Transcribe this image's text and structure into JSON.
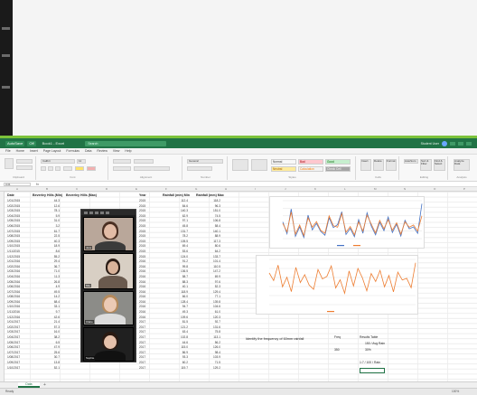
{
  "window": {
    "title_buttons": [
      "AutoSave",
      "Off"
    ],
    "doc_name": "Book1 - Excel",
    "search_placeholder": "Search",
    "user": "Student User",
    "controls": [
      "minimize",
      "maximize",
      "close"
    ]
  },
  "menu": [
    "File",
    "Home",
    "Insert",
    "Page Layout",
    "Formulas",
    "Data",
    "Review",
    "View",
    "Help"
  ],
  "ribbon": {
    "groups": [
      "Clipboard",
      "Font",
      "Alignment",
      "Number",
      "Styles",
      "Cells",
      "Editing",
      "Analysis"
    ],
    "font_name": "Calibri",
    "font_size": "11",
    "number_format": "General",
    "styles": [
      {
        "label": "Normal",
        "color": "#ffffff"
      },
      {
        "label": "Bad",
        "color": "#ffc7ce"
      },
      {
        "label": "Good",
        "color": "#c6efce"
      },
      {
        "label": "Neutral",
        "color": "#ffeb9c"
      },
      {
        "label": "Calculation",
        "color": "#f2f2f2"
      },
      {
        "label": "Check Cell",
        "color": "#a5a5a5"
      }
    ],
    "cells_buttons": [
      "Insert",
      "Delete",
      "Format"
    ],
    "editing_buttons": [
      "AutoSum",
      "Sort & Filter",
      "Find & Select"
    ],
    "analysis_button": "Analyze Data"
  },
  "formula_bar": {
    "name_box": "C41",
    "fx": "fx"
  },
  "columns": [
    "A",
    "B",
    "C",
    "D",
    "E",
    "F",
    "G",
    "H",
    "I",
    "J",
    "K",
    "L",
    "M",
    "N",
    "O",
    "P"
  ],
  "table": {
    "headers": [
      "Date",
      "Beverley Hills (Min)",
      "Beverley Hills (Max)",
      "Year",
      "Rainfall (mm) Min",
      "Rainfall (mm) Max"
    ],
    "dates": [
      "1/01/2015",
      "1/02/2015",
      "1/03/2015",
      "1/04/2015",
      "1/05/2015",
      "1/06/2015",
      "1/07/2015",
      "1/08/2015",
      "1/09/2015",
      "1/10/2015",
      "1/11/2015",
      "1/12/2015",
      "1/01/2016",
      "1/02/2016",
      "1/03/2016",
      "1/04/2016",
      "1/05/2016",
      "1/06/2016",
      "1/07/2016",
      "1/08/2016",
      "1/09/2016",
      "1/10/2016",
      "1/11/2016",
      "1/12/2016",
      "1/01/2017",
      "1/02/2017",
      "1/03/2017",
      "1/04/2017",
      "1/05/2017",
      "1/06/2017",
      "1/07/2017",
      "1/08/2017",
      "1/09/2017",
      "1/10/2017"
    ],
    "min": [
      "44.3",
      "12.6",
      "78.1",
      "5.9",
      "31.0",
      "3.2",
      "61.7",
      "22.5",
      "40.3",
      "18.9",
      "8.6",
      "55.2",
      "29.4",
      "36.7",
      "71.0",
      "11.3",
      "26.8",
      "4.9",
      "49.5",
      "14.2",
      "68.4",
      "33.1",
      "9.7",
      "42.6",
      "21.4",
      "57.3",
      "16.0",
      "38.2",
      "6.5",
      "47.9",
      "25.6",
      "30.7",
      "13.8",
      "52.1"
    ],
    "year": [
      "2015",
      "2015",
      "2015",
      "2015",
      "2015",
      "2015",
      "2015",
      "2015",
      "2015",
      "2015",
      "2015",
      "2015",
      "2016",
      "2016",
      "2016",
      "2016",
      "2016",
      "2016",
      "2016",
      "2016",
      "2016",
      "2016",
      "2016",
      "2016",
      "2017",
      "2017",
      "2017",
      "2017",
      "2017",
      "2017",
      "2017",
      "2017",
      "2017",
      "2017"
    ],
    "rain_min": [
      "112.4",
      "84.6",
      "140.3",
      "62.9",
      "97.1",
      "45.8",
      "131.7",
      "78.2",
      "105.5",
      "69.4",
      "53.6",
      "124.0",
      "91.2",
      "99.8",
      "136.5",
      "58.7",
      "88.3",
      "40.1",
      "118.9",
      "66.0",
      "128.4",
      "94.7",
      "49.3",
      "109.6",
      "81.5",
      "121.2",
      "63.4",
      "102.8",
      "44.6",
      "115.0",
      "86.9",
      "93.3",
      "60.2",
      "119.7"
    ],
    "rain_max": [
      "118.2",
      "96.3",
      "151.0",
      "74.5",
      "106.8",
      "58.4",
      "140.1",
      "88.9",
      "117.3",
      "80.6",
      "64.2",
      "133.7",
      "101.4",
      "110.5",
      "147.2",
      "69.9",
      "97.6",
      "52.3",
      "129.4",
      "77.1",
      "139.8",
      "104.6",
      "61.0",
      "120.3",
      "92.7",
      "131.6",
      "75.8",
      "113.1",
      "56.2",
      "126.0",
      "98.4",
      "103.9",
      "71.5",
      "129.2"
    ]
  },
  "video_call": {
    "participants": [
      "Jess",
      "Mia",
      "Claire",
      "Sophie"
    ]
  },
  "chart_data": [
    {
      "type": "line",
      "x": [
        "1",
        "2",
        "3",
        "4",
        "5",
        "6",
        "7",
        "8",
        "9",
        "10",
        "11",
        "12",
        "13",
        "14",
        "15",
        "16",
        "17",
        "18",
        "19",
        "20",
        "21",
        "22",
        "23",
        "24",
        "25",
        "26",
        "27",
        "28",
        "29",
        "30",
        "31",
        "32",
        "33",
        "34"
      ],
      "series": [
        {
          "name": "",
          "color": "#4472c4",
          "values": [
            44,
            13,
            78,
            6,
            31,
            3,
            62,
            23,
            40,
            19,
            9,
            55,
            29,
            37,
            71,
            11,
            27,
            5,
            50,
            14,
            68,
            33,
            10,
            43,
            21,
            57,
            16,
            38,
            7,
            48,
            26,
            31,
            14,
            92
          ]
        },
        {
          "name": "",
          "color": "#ed7d31",
          "values": [
            40,
            18,
            70,
            12,
            36,
            8,
            55,
            30,
            45,
            22,
            14,
            60,
            34,
            30,
            66,
            17,
            32,
            10,
            44,
            20,
            62,
            38,
            15,
            48,
            26,
            50,
            22,
            42,
            12,
            44,
            30,
            36,
            20,
            60
          ]
        }
      ],
      "ylim": [
        0,
        100
      ],
      "grid": true,
      "legend": "bottom"
    },
    {
      "type": "line",
      "x": [
        "1",
        "2",
        "3",
        "4",
        "5",
        "6",
        "7",
        "8",
        "9",
        "10",
        "11",
        "12",
        "13",
        "14",
        "15",
        "16",
        "17",
        "18",
        "19",
        "20",
        "21",
        "22",
        "23",
        "24",
        "25",
        "26",
        "27",
        "28",
        "29",
        "30",
        "31",
        "32",
        "33",
        "34"
      ],
      "series": [
        {
          "name": "",
          "color": "#ed7d31",
          "values": [
            112,
            85,
            140,
            63,
            97,
            46,
            132,
            78,
            106,
            69,
            54,
            124,
            91,
            100,
            137,
            59,
            88,
            40,
            119,
            66,
            128,
            95,
            49,
            110,
            82,
            121,
            63,
            103,
            45,
            115,
            87,
            93,
            60,
            148
          ]
        }
      ],
      "ylim": [
        0,
        160
      ],
      "grid": true,
      "legend": "bottom"
    }
  ],
  "question": "Identify the frequency of 60mm rainfall",
  "result": {
    "head1": "Freq",
    "head2": "Results Table",
    "lines": [
      "150 / Avg Rain",
      "350",
      "30%",
      "1:7 / 100 / Rain"
    ]
  },
  "sheet_tab": "Data",
  "status": {
    "left": "Ready",
    "right": "100%"
  }
}
